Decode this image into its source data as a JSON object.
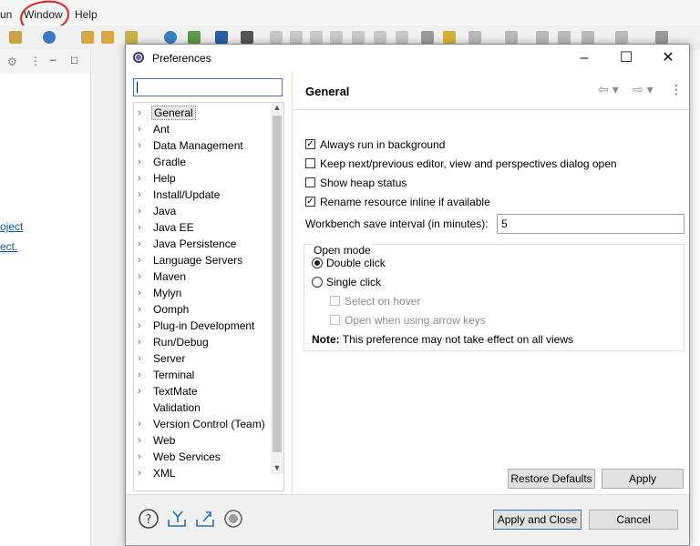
{
  "menubar": {
    "items": [
      "un",
      "Window",
      "Help"
    ]
  },
  "left_links": [
    "oject",
    "ect."
  ],
  "dialog": {
    "title": "Preferences",
    "filter_placeholder": "",
    "tree": [
      {
        "label": "General",
        "expandable": true,
        "selected": true
      },
      {
        "label": "Ant",
        "expandable": true
      },
      {
        "label": "Data Management",
        "expandable": true
      },
      {
        "label": "Gradle",
        "expandable": true
      },
      {
        "label": "Help",
        "expandable": true
      },
      {
        "label": "Install/Update",
        "expandable": true
      },
      {
        "label": "Java",
        "expandable": true
      },
      {
        "label": "Java EE",
        "expandable": true
      },
      {
        "label": "Java Persistence",
        "expandable": true
      },
      {
        "label": "Language Servers",
        "expandable": true
      },
      {
        "label": "Maven",
        "expandable": true
      },
      {
        "label": "Mylyn",
        "expandable": true
      },
      {
        "label": "Oomph",
        "expandable": true
      },
      {
        "label": "Plug-in Development",
        "expandable": true
      },
      {
        "label": "Run/Debug",
        "expandable": true
      },
      {
        "label": "Server",
        "expandable": true
      },
      {
        "label": "Terminal",
        "expandable": true
      },
      {
        "label": "TextMate",
        "expandable": true
      },
      {
        "label": "Validation",
        "expandable": false
      },
      {
        "label": "Version Control (Team)",
        "expandable": true
      },
      {
        "label": "Web",
        "expandable": true
      },
      {
        "label": "Web Services",
        "expandable": true
      },
      {
        "label": "XML",
        "expandable": true
      }
    ],
    "page": {
      "title": "General",
      "checkboxes": [
        {
          "label": "Always run in background",
          "checked": true
        },
        {
          "label": "Keep next/previous editor, view and perspectives dialog open",
          "checked": false
        },
        {
          "label": "Show heap status",
          "checked": false
        },
        {
          "label": "Rename resource inline if available",
          "checked": true
        }
      ],
      "interval_label": "Workbench save interval (in minutes):",
      "interval_value": "5",
      "open_mode": {
        "title": "Open mode",
        "options": [
          {
            "label": "Double click",
            "selected": true
          },
          {
            "label": "Single click",
            "selected": false
          }
        ],
        "sub_options": [
          {
            "label": "Select on hover",
            "checked": false,
            "disabled": true
          },
          {
            "label": "Open when using arrow keys",
            "checked": false,
            "disabled": true
          }
        ],
        "note_bold": "Note:",
        "note_text": " This preference may not take effect on all views"
      },
      "restore_defaults": "Restore Defaults",
      "apply": "Apply"
    },
    "footer": {
      "apply_close": "Apply and Close",
      "cancel": "Cancel"
    }
  }
}
